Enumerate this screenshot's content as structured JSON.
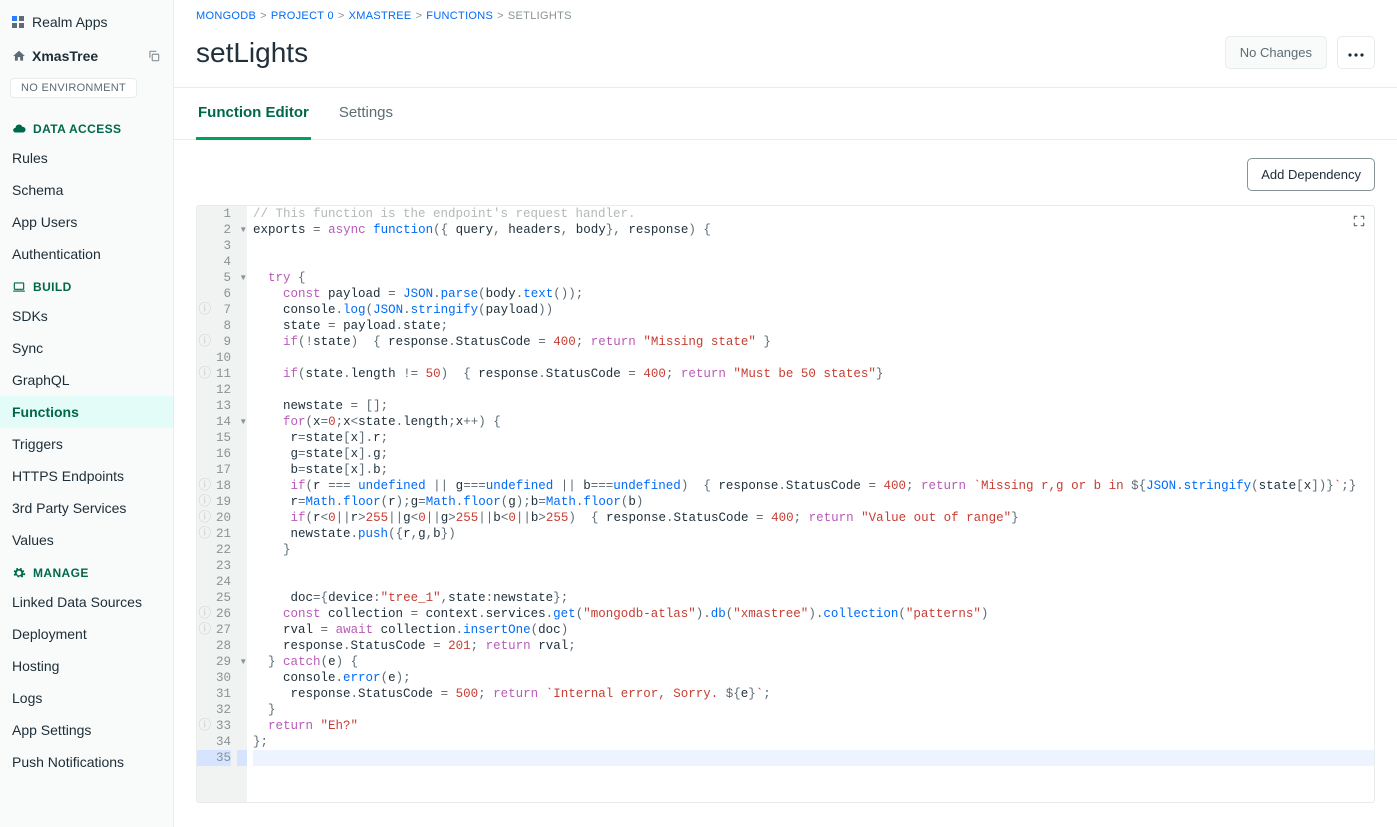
{
  "brand": "Realm Apps",
  "app_name": "XmasTree",
  "env_label": "NO ENVIRONMENT",
  "sections": {
    "data_access": {
      "label": "DATA ACCESS",
      "items": [
        "Rules",
        "Schema",
        "App Users",
        "Authentication"
      ]
    },
    "build": {
      "label": "BUILD",
      "items": [
        "SDKs",
        "Sync",
        "GraphQL",
        "Functions",
        "Triggers",
        "HTTPS Endpoints",
        "3rd Party Services",
        "Values"
      ]
    },
    "manage": {
      "label": "MANAGE",
      "items": [
        "Linked Data Sources",
        "Deployment",
        "Hosting",
        "Logs",
        "App Settings",
        "Push Notifications"
      ]
    }
  },
  "active_nav": "Functions",
  "breadcrumbs": [
    {
      "label": "MONGODB",
      "link": true
    },
    {
      "label": "PROJECT 0",
      "link": true
    },
    {
      "label": "XMASTREE",
      "link": true
    },
    {
      "label": "FUNCTIONS",
      "link": true
    },
    {
      "label": "SETLIGHTS",
      "link": false
    }
  ],
  "page_title": "setLights",
  "no_changes": "No Changes",
  "tabs": [
    "Function Editor",
    "Settings"
  ],
  "active_tab": "Function Editor",
  "add_dep": "Add Dependency",
  "lint_lines": [
    7,
    9,
    11,
    18,
    19,
    20,
    21,
    26,
    27,
    33
  ],
  "fold_lines": [
    2,
    5,
    14,
    29
  ],
  "active_line": 35,
  "line_count": 35
}
